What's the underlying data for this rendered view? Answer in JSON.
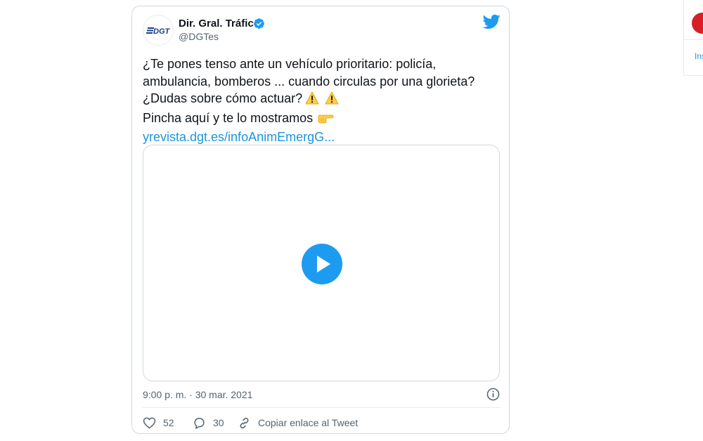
{
  "tweet": {
    "author_name": "Dir. Gral. Tráfico",
    "author_handle": "@DGTes",
    "avatar_logo_text": "DGT",
    "text_lines": [
      "¿Te pones tenso ante un vehículo prioritario: policía,",
      "ambulancia, bomberos  ... cuando circulas por una glorieta?",
      "¿Dudas sobre cómo actuar?",
      "Pincha aquí y te lo mostramos"
    ],
    "link": "yrevista.dgt.es/infoAnimEmergG...",
    "emojis": {
      "warning": "⚠️",
      "pointing_right": "👉"
    },
    "timestamp": "9:00 p. m. · 30 mar. 2021",
    "likes": "52",
    "replies": "30",
    "copy_link_label": "Copiar enlace al Tweet"
  },
  "right_panel": {
    "text": "Ins"
  },
  "colors": {
    "accent": "#1d9bf0",
    "link": "#1b95e0",
    "muted": "#536471",
    "border": "#cfd9de",
    "logo_blue": "#1a3e8c"
  },
  "icons": [
    "verified-badge-icon",
    "twitter-bird-icon",
    "play-icon",
    "info-icon",
    "heart-icon",
    "reply-icon",
    "link-icon"
  ]
}
